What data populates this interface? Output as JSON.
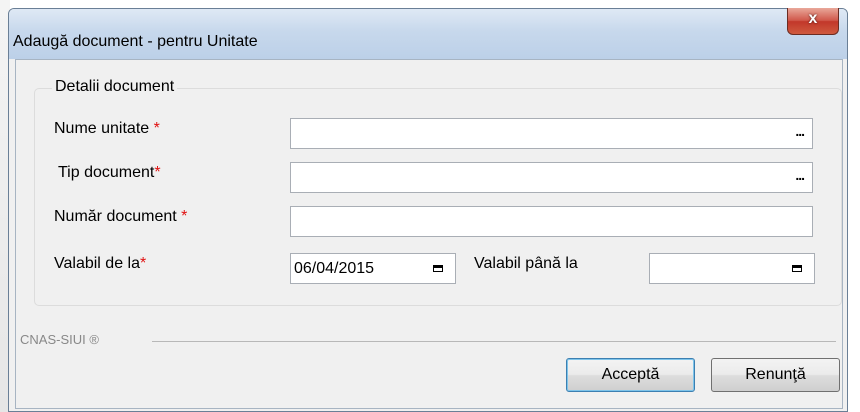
{
  "window": {
    "title": "Adaugă document - pentru Unitate",
    "close_label": "x"
  },
  "group": {
    "title": "Detalii document"
  },
  "form": {
    "nume_unitate": {
      "label": "Nume unitate ",
      "required_mark": "*",
      "value": "",
      "browse_label": "..."
    },
    "tip_document": {
      "label": "Tip document",
      "required_mark": "*",
      "value": "",
      "browse_label": "..."
    },
    "numar_document": {
      "label": "Număr document ",
      "required_mark": "*",
      "value": ""
    },
    "valabil_de_la": {
      "label": "Valabil de la",
      "required_mark": "*",
      "value": "06/04/2015"
    },
    "valabil_pana_la": {
      "label": "Valabil până la",
      "value": ""
    }
  },
  "footer": {
    "brand": "CNAS-SIUI ®"
  },
  "buttons": {
    "accept": "Acceptă",
    "cancel": "Renunţă"
  },
  "colors": {
    "required": "#e01010",
    "titlebar": "#c7d8ec",
    "close_button": "#c2372a"
  }
}
